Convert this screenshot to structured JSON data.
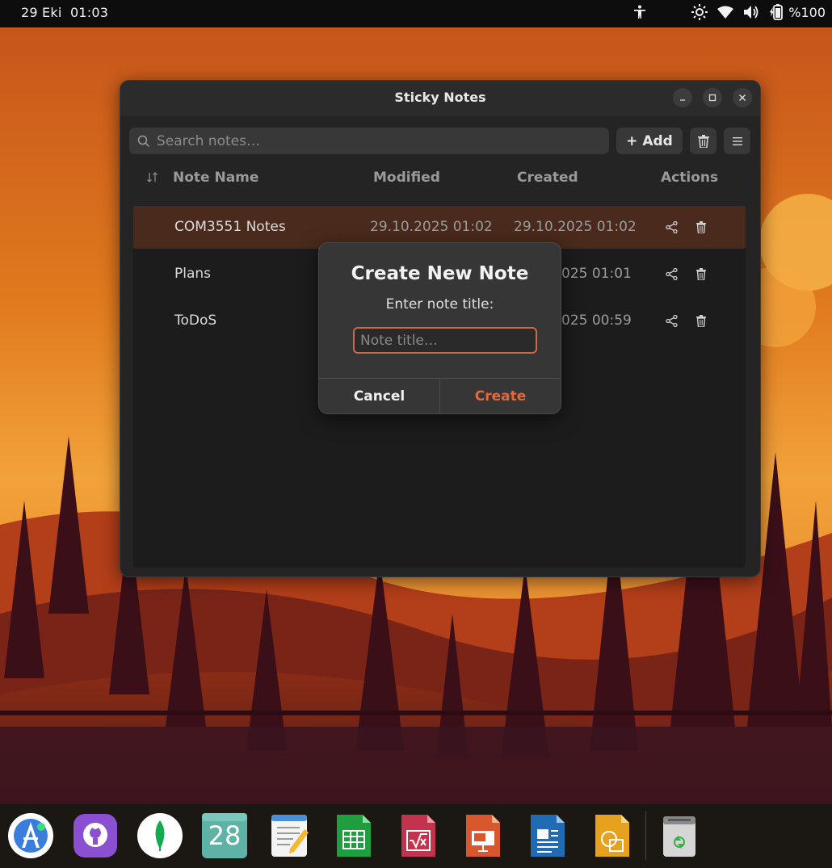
{
  "topbar": {
    "date": "29 Eki",
    "time": "01:03",
    "battery_percent": "%100",
    "icons": [
      "accessibility-icon",
      "brightness-icon",
      "wifi-icon",
      "volume-icon",
      "battery-icon"
    ]
  },
  "window": {
    "title": "Sticky Notes",
    "controls": [
      "minimize-icon",
      "maximize-icon",
      "close-icon"
    ]
  },
  "toolbar": {
    "search_placeholder": "Search notes…",
    "add_label": "+ Add",
    "delete_icon": "trash-icon",
    "menu_icon": "hamburger-menu-icon"
  },
  "table": {
    "columns": [
      "Note Name",
      "Modified",
      "Created",
      "Actions"
    ],
    "sort_icon": "sort-icon",
    "rows": [
      {
        "name": "COM3551 Notes",
        "modified": "29.10.2025 01:02",
        "created": "29.10.2025 01:02",
        "selected": true
      },
      {
        "name": "Plans",
        "modified": "",
        "created": "025 01:01",
        "selected": false
      },
      {
        "name": "ToDoS",
        "modified": "",
        "created": "025 00:59",
        "selected": false
      }
    ]
  },
  "dialog": {
    "title": "Create New Note",
    "subtitle": "Enter note title:",
    "input_placeholder": "Note title…",
    "input_value": "",
    "cancel_label": "Cancel",
    "create_label": "Create",
    "accent_color": "#e8673a"
  },
  "dock": {
    "apps": [
      {
        "name": "android-studio-icon",
        "label": ""
      },
      {
        "name": "github-desktop-icon",
        "label": ""
      },
      {
        "name": "mongodb-compass-icon",
        "label": ""
      },
      {
        "name": "calendar-icon",
        "label": "28"
      },
      {
        "name": "text-editor-icon",
        "label": ""
      },
      {
        "name": "libreoffice-calc-icon",
        "label": ""
      },
      {
        "name": "libreoffice-math-icon",
        "label": ""
      },
      {
        "name": "libreoffice-impress-icon",
        "label": ""
      },
      {
        "name": "libreoffice-writer-icon",
        "label": ""
      },
      {
        "name": "libreoffice-draw-icon",
        "label": ""
      },
      {
        "name": "trash-bin-icon",
        "label": ""
      }
    ]
  }
}
